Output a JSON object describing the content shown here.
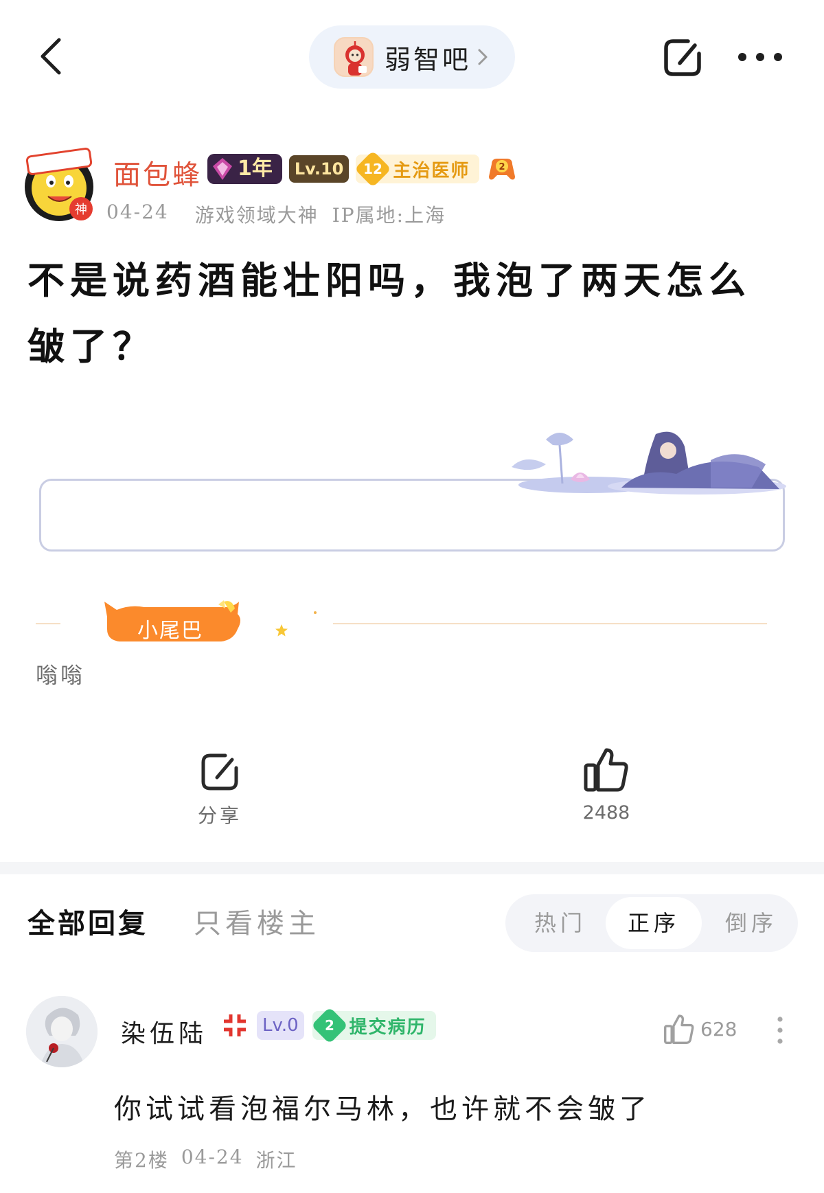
{
  "nav": {
    "forum_name": "弱智吧",
    "icons": [
      "back-icon",
      "share-icon",
      "more-icon",
      "chevron-right-icon"
    ]
  },
  "author": {
    "name": "面包蜂",
    "avatar_stamp": "神",
    "badge_year": "1年",
    "badge_level": "Lv.10",
    "rank_number": "12",
    "rank_title": "主治医师",
    "game_badge_number": "2",
    "date": "04-24",
    "title_tag": "游戏领域大神",
    "ip_location": "IP属地:上海"
  },
  "post": {
    "title": "不是说药酒能壮阳吗，我泡了两天怎么皱了？",
    "tail_badge_label": "小尾巴",
    "tail_text": "嗡嗡"
  },
  "actions": {
    "share_label": "分享",
    "like_count": "2488"
  },
  "reply_tabs": {
    "all": "全部回复",
    "owner_only": "只看楼主",
    "sort_hot": "热门",
    "sort_asc": "正序",
    "sort_desc": "倒序",
    "active_sort": "正序"
  },
  "reply": {
    "username": "染伍陆",
    "badge_level": "Lv.0",
    "rank_number": "2",
    "rank_title": "提交病历",
    "like_count": "628",
    "text": "你试试看泡福尔马林，也许就不会皱了",
    "floor": "第2楼",
    "date": "04-24",
    "location": "浙江"
  },
  "colors": {
    "author_name": "#e0533a",
    "forum_pill_bg": "#eef3fb",
    "rank_gold": "#f6b622",
    "rank_green": "#34c277",
    "tail_orange": "#fb8a2c"
  }
}
